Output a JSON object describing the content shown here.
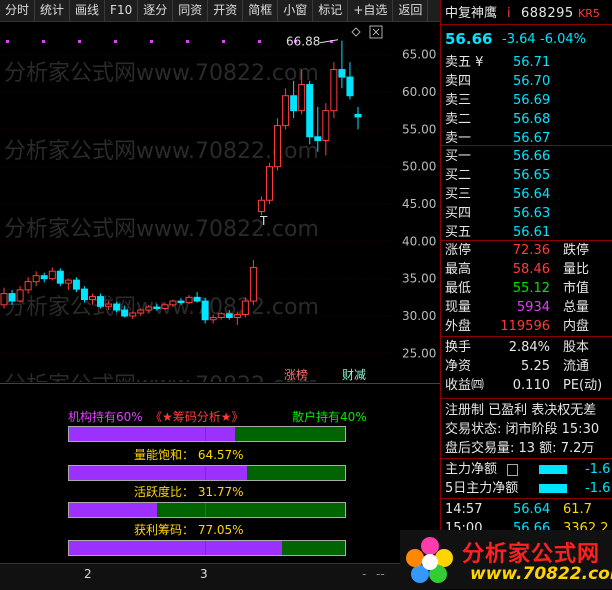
{
  "toolbar": {
    "items": [
      "分时",
      "统计",
      "画线",
      "F10",
      "逐分",
      "同资",
      "开资",
      "简框",
      "小窗",
      "标记",
      "+自选",
      "返回"
    ]
  },
  "chart": {
    "y_ticks": [
      "65.00",
      "60.00",
      "55.00",
      "50.00",
      "45.00",
      "40.00",
      "35.00",
      "30.00",
      "25.00"
    ],
    "y_values": [
      65,
      60,
      55,
      50,
      45,
      40,
      35,
      30,
      25
    ],
    "high_label": "66.88",
    "t_mark": "T",
    "badge_zhangbang": "涨榜",
    "badge_caijian": "财减",
    "watermark": "分析家公式网www.70822.com",
    "candles": [
      [
        31.5,
        33.8,
        31.0,
        33.0
      ],
      [
        33.0,
        33.5,
        31.5,
        32.0
      ],
      [
        32.0,
        34.0,
        31.8,
        33.5
      ],
      [
        33.5,
        35.2,
        33.0,
        34.6
      ],
      [
        34.6,
        36.0,
        34.0,
        35.4
      ],
      [
        35.4,
        35.8,
        34.5,
        35.0
      ],
      [
        35.0,
        36.5,
        34.8,
        36.0
      ],
      [
        36.0,
        36.4,
        34.0,
        34.4
      ],
      [
        34.4,
        35.0,
        33.5,
        34.8
      ],
      [
        34.8,
        35.2,
        33.2,
        33.6
      ],
      [
        33.6,
        34.0,
        31.8,
        32.2
      ],
      [
        32.2,
        33.0,
        31.5,
        32.6
      ],
      [
        32.6,
        33.0,
        31.0,
        31.3
      ],
      [
        31.3,
        32.0,
        30.8,
        31.6
      ],
      [
        31.6,
        31.9,
        30.5,
        30.8
      ],
      [
        30.8,
        31.4,
        29.8,
        30.0
      ],
      [
        30.0,
        30.6,
        29.6,
        30.4
      ],
      [
        30.4,
        31.0,
        30.0,
        30.8
      ],
      [
        30.8,
        31.5,
        30.5,
        31.2
      ],
      [
        31.2,
        31.6,
        30.7,
        31.0
      ],
      [
        31.0,
        31.8,
        30.8,
        31.5
      ],
      [
        31.5,
        32.2,
        31.2,
        32.0
      ],
      [
        32.0,
        32.4,
        31.5,
        31.8
      ],
      [
        31.8,
        32.8,
        31.6,
        32.5
      ],
      [
        32.5,
        33.2,
        31.8,
        32.0
      ],
      [
        32.0,
        32.4,
        29.0,
        29.5
      ],
      [
        29.5,
        30.2,
        29.0,
        29.8
      ],
      [
        29.8,
        30.5,
        29.5,
        30.3
      ],
      [
        30.3,
        30.8,
        29.5,
        29.8
      ],
      [
        29.8,
        30.6,
        28.8,
        30.2
      ],
      [
        30.2,
        32.5,
        29.8,
        32.0
      ],
      [
        32.0,
        37.5,
        31.5,
        36.5
      ],
      [
        44.0,
        46.0,
        43.5,
        45.5
      ],
      [
        45.5,
        50.5,
        45.0,
        50.0
      ],
      [
        50.0,
        56.5,
        49.5,
        55.5
      ],
      [
        55.5,
        60.5,
        55.0,
        59.5
      ],
      [
        59.5,
        61.5,
        56.5,
        57.5
      ],
      [
        57.5,
        63.0,
        57.0,
        61.0
      ],
      [
        61.0,
        61.5,
        53.0,
        54.0
      ],
      [
        54.0,
        58.0,
        52.0,
        53.5
      ],
      [
        53.5,
        58.5,
        51.5,
        57.5
      ],
      [
        57.5,
        64.0,
        56.5,
        63.0
      ],
      [
        63.0,
        66.88,
        60.5,
        62.0
      ],
      [
        62.0,
        64.0,
        59.0,
        59.5
      ],
      [
        57.0,
        58.0,
        55.0,
        56.66
      ]
    ]
  },
  "chip": {
    "title_left": "机构持有60%",
    "title_mid": "《★筹码分析★》",
    "title_right": "散户持有40%",
    "bars": [
      {
        "label": "",
        "value": 0.6
      },
      {
        "label": "量能饱和：  64.57%",
        "value": 0.6457
      },
      {
        "label": "活跃度比：  31.77%",
        "value": 0.3177
      },
      {
        "label": "获利筹码：  77.05%",
        "value": 0.7705
      }
    ]
  },
  "bottom": {
    "axis_labels": [
      "2",
      "3"
    ],
    "scroll_left": "-",
    "scroll_right": "--"
  },
  "quote": {
    "name": "中复神鹰",
    "flag": "i",
    "code": "688295",
    "kr": "KR5",
    "price": "56.66",
    "change": "-3.64",
    "pct": "-6.04%",
    "sell": [
      [
        "卖五 ¥",
        "56.71"
      ],
      [
        "卖四",
        "56.70"
      ],
      [
        "卖三",
        "56.69"
      ],
      [
        "卖二",
        "56.68"
      ],
      [
        "卖一",
        "56.67"
      ]
    ],
    "buy": [
      [
        "买一",
        "56.66"
      ],
      [
        "买二",
        "56.65"
      ],
      [
        "买三",
        "56.64"
      ],
      [
        "买四",
        "56.63"
      ],
      [
        "买五",
        "56.61"
      ]
    ],
    "stats": [
      [
        "涨停",
        "72.36",
        "跌停"
      ],
      [
        "最高",
        "58.46",
        "量比"
      ],
      [
        "最低",
        "55.12",
        "市值"
      ],
      [
        "现量",
        "5934",
        "总量"
      ],
      [
        "外盘",
        "119596",
        "内盘"
      ]
    ],
    "stats2": [
      [
        "换手",
        "2.84%",
        "股本"
      ],
      [
        "净资",
        "5.25",
        "流通"
      ],
      [
        "收益㈣",
        "0.110",
        "PE(动)"
      ]
    ],
    "tags": "注册制 已盈利 表决权无差",
    "status": "交易状态: 闭市阶段 15:30",
    "after": "盘后交易量: 13  额: 7.2万",
    "flow1_label": "主力净额",
    "flow1_value": "-1.6",
    "flow2_label": "5日主力净额",
    "flow2_value": "-1.6",
    "ticks": [
      [
        "14:57",
        "56.64",
        "61.7"
      ],
      [
        "15:00",
        "56.66",
        "3362 2"
      ]
    ]
  },
  "logo": {
    "text": "分析家公式网",
    "url": "www.70822.com"
  }
}
